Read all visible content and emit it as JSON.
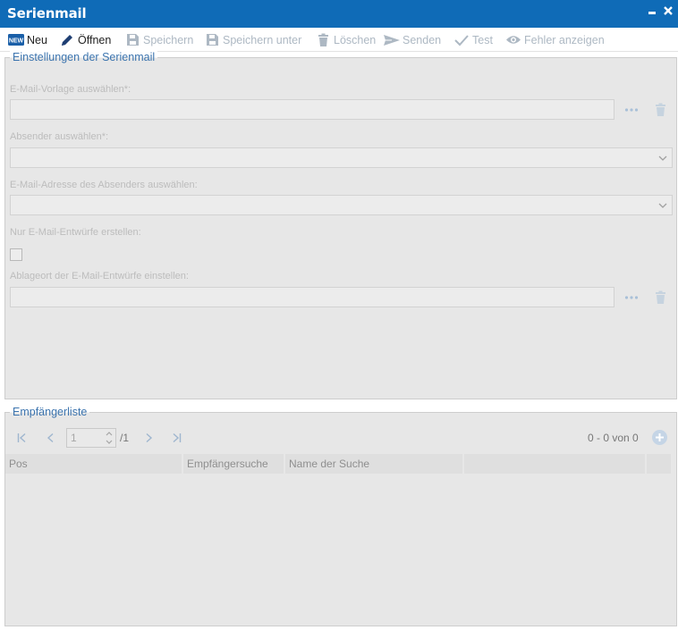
{
  "window": {
    "title": "Serienmail"
  },
  "toolbar": {
    "new_label": "Neu",
    "new_badge": "NEW",
    "open_label": "Öffnen",
    "save_label": "Speichern",
    "save_as_label": "Speichern unter",
    "delete_label": "Löschen",
    "send_label": "Senden",
    "test_label": "Test",
    "errors_label": "Fehler anzeigen"
  },
  "settings": {
    "legend": "Einstellungen der Serienmail",
    "template_label": "E-Mail-Vorlage auswählen*:",
    "template_value": "",
    "sender_label": "Absender auswählen*:",
    "sender_value": "",
    "sender_email_label": "E-Mail-Adresse des Absenders auswählen:",
    "sender_email_value": "",
    "drafts_only_label": "Nur E-Mail-Entwürfe erstellen:",
    "drafts_only_checked": false,
    "draft_location_label": "Ablageort der E-Mail-Entwürfe einstellen:",
    "draft_location_value": ""
  },
  "recipients": {
    "legend": "Empfängerliste",
    "pager": {
      "page": "1",
      "total": "/1",
      "count": "0 - 0 von 0"
    },
    "columns": [
      "Pos",
      "Empfängersuche",
      "Name der Suche",
      "",
      ""
    ],
    "rows": []
  },
  "colors": {
    "titlebar": "#0f6bb7",
    "legend_text": "#3c74ae",
    "panel_bg": "#e7e7e7",
    "disabled_icon": "#adb8c3"
  },
  "icons": [
    "new-badge-icon",
    "pencil-icon",
    "floppy-disk-icon",
    "trash-icon",
    "send-arrow-icon",
    "checkmark-icon",
    "eye-icon",
    "ellipsis-icon",
    "chevron-down-icon",
    "first-page-icon",
    "prev-page-icon",
    "next-page-icon",
    "last-page-icon",
    "plus-circle-icon"
  ]
}
